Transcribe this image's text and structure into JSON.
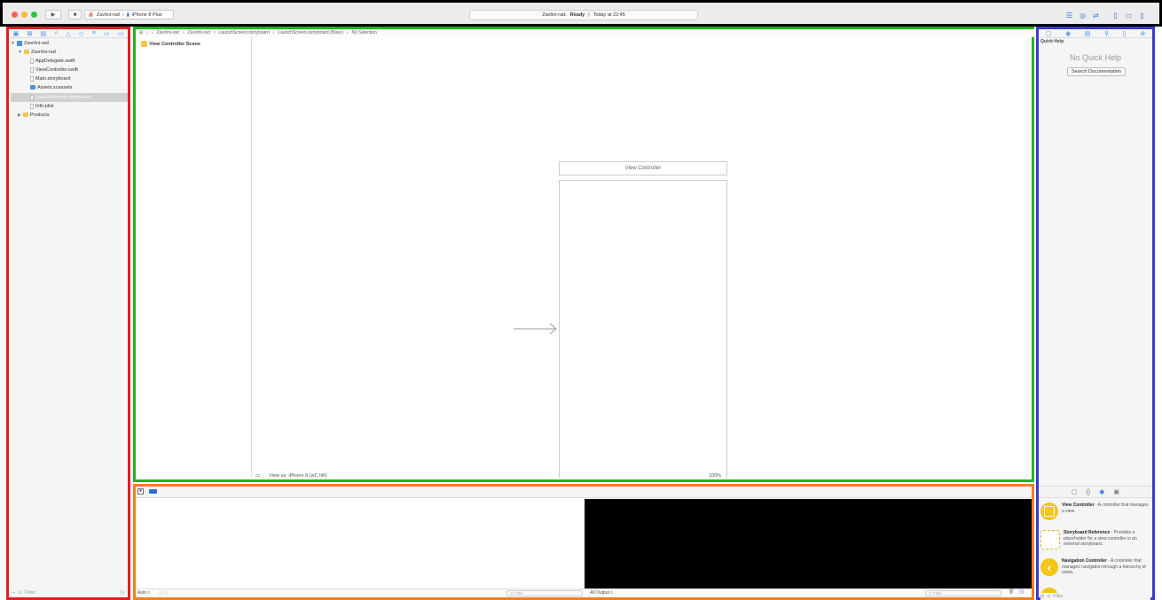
{
  "toolbar": {
    "scheme_target": "Zavšni-rad",
    "scheme_device": "iPhone 8 Plus",
    "activity_project": "Zavšni-rad:",
    "activity_status": "Ready",
    "activity_separator": "|",
    "activity_time": "Today at 22:45",
    "traffic_colors": [
      "#fc5f57",
      "#fdbc2e",
      "#28c840"
    ],
    "accent": "#2b6fd6"
  },
  "navigator": {
    "tree": [
      {
        "label": "Završni-rad",
        "kind": "project",
        "indent": 0,
        "disclosure": "▼"
      },
      {
        "label": "Završni-rad",
        "kind": "folder",
        "indent": 1,
        "disclosure": "▼"
      },
      {
        "label": "AppDelegate.swift",
        "kind": "file",
        "indent": 2
      },
      {
        "label": "ViewController.swift",
        "kind": "file",
        "indent": 2
      },
      {
        "label": "Main.storyboard",
        "kind": "file",
        "indent": 2
      },
      {
        "label": "Assets.xcassets",
        "kind": "folder",
        "indent": 2
      },
      {
        "label": "LaunchScreen.storyboard",
        "kind": "file",
        "indent": 2,
        "selected": true
      },
      {
        "label": "Info.plist",
        "kind": "file",
        "indent": 2
      },
      {
        "label": "Products",
        "kind": "folder",
        "indent": 1,
        "disclosure": "▶"
      }
    ],
    "filter_placeholder": "Filter"
  },
  "editor": {
    "breadcrumbs": [
      "Završni-rad",
      "Završni-rad",
      "LaunchScreen.storyboard",
      "LaunchScreen.storyboard (Base)",
      "No Selection"
    ],
    "scene_label": "View Controller Scene",
    "vc_title": "View Controller",
    "device_label": "View as: iPhone 8 (wC hR)",
    "zoom_label": "100%"
  },
  "debug": {
    "auto_label": "Auto ◊",
    "filter_placeholder": "Filter",
    "output_label": "All Output ◊"
  },
  "inspector": {
    "quick_help_title": "Quick Help",
    "no_help": "No Quick Help",
    "search_button": "Search Documentation",
    "library": [
      {
        "name": "View Controller",
        "desc": "- A controller that manages a view."
      },
      {
        "name": "Storyboard Reference",
        "desc": "- Provides a placeholder for a view controller in an external storyboard."
      },
      {
        "name": "Navigation Controller",
        "desc": "- A controller that manages navigation through a hierarchy of views."
      }
    ],
    "filter_placeholder": "Filter"
  }
}
